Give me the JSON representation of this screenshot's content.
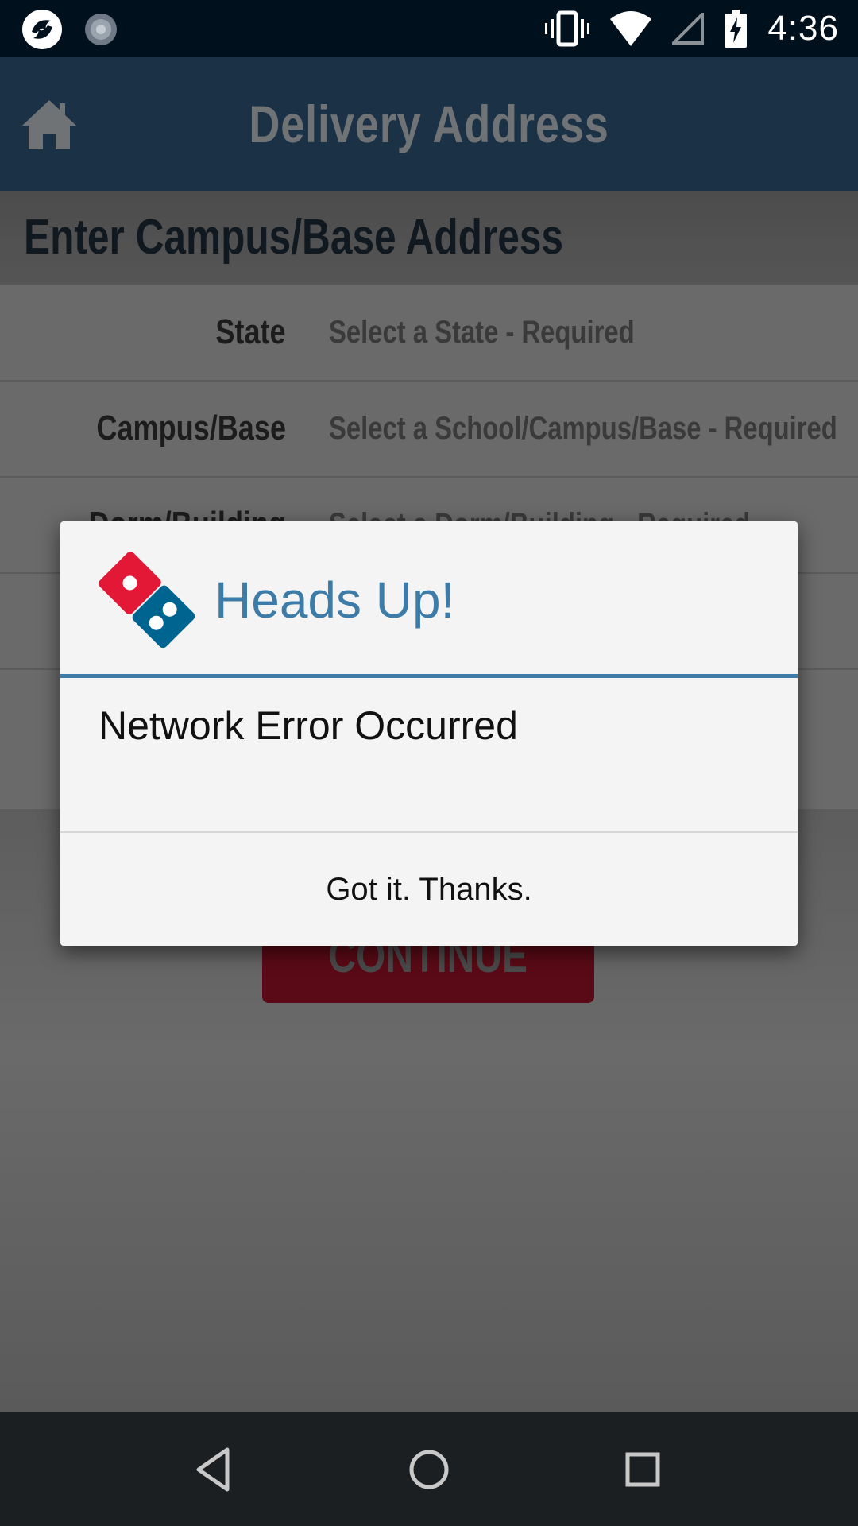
{
  "status_bar": {
    "time": "4:36",
    "left_icons": [
      "app-notification-icon",
      "sync-notification-icon"
    ],
    "right_icons": [
      "vibrate-icon",
      "wifi-icon",
      "cell-signal-icon",
      "battery-charging-icon"
    ]
  },
  "header": {
    "title": "Delivery Address",
    "home_icon": "home-icon"
  },
  "section": {
    "heading": "Enter Campus/Base Address"
  },
  "form": {
    "rows": [
      {
        "label": "State",
        "placeholder": "Select a State - Required"
      },
      {
        "label": "Campus/Base",
        "placeholder": "Select a School/Campus/Base - Required"
      },
      {
        "label": "Dorm/Building",
        "placeholder": "Select a Dorm/Building - Required"
      }
    ]
  },
  "continue_button": {
    "label": "CONTINUE"
  },
  "dialog": {
    "title": "Heads Up!",
    "message": "Network Error Occurred",
    "button_label": "Got it. Thanks.",
    "logo_icon": "dominos-logo-icon"
  },
  "nav_bar": {
    "back_icon": "back-icon",
    "home_icon": "home-circle-icon",
    "recents_icon": "recents-icon"
  },
  "colors": {
    "status_bar_bg": "#00111d",
    "header_bg": "#1b3146",
    "dialog_accent": "#3d7ca8",
    "logo_red": "#e31837",
    "logo_blue": "#006491",
    "continue_red": "#5a0a16"
  }
}
